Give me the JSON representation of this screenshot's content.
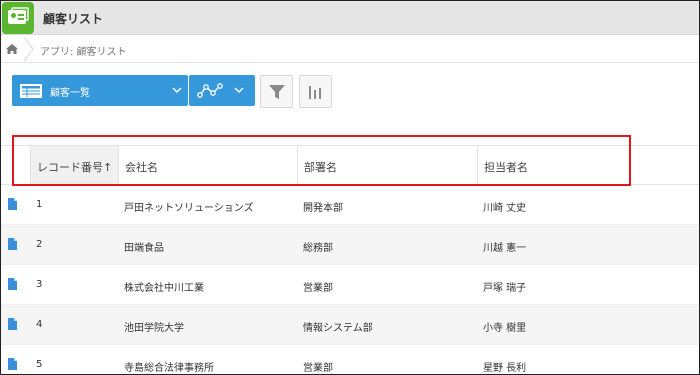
{
  "app": {
    "title": "顧客リスト"
  },
  "breadcrumb": {
    "text": "アプリ: 顧客リスト"
  },
  "toolbar": {
    "view_label": "顧客一覧",
    "accent_color": "#3498db"
  },
  "table": {
    "columns": [
      {
        "label": "レコード番号↑"
      },
      {
        "label": "会社名"
      },
      {
        "label": "部署名"
      },
      {
        "label": "担当者名"
      }
    ],
    "rows": [
      {
        "id": "1",
        "company": "戸田ネットソリューションズ",
        "dept": "開発本部",
        "person": "川崎 丈史"
      },
      {
        "id": "2",
        "company": "田端食品",
        "dept": "総務部",
        "person": "川越 憲一"
      },
      {
        "id": "3",
        "company": "株式会社中川工業",
        "dept": "営業部",
        "person": "戸塚 瑞子"
      },
      {
        "id": "4",
        "company": "池田学院大学",
        "dept": "情報システム部",
        "person": "小寺 樹里"
      },
      {
        "id": "5",
        "company": "寺島総合法律事務所",
        "dept": "営業部",
        "person": "星野 長利"
      }
    ]
  },
  "highlight_color": "#e0161d"
}
